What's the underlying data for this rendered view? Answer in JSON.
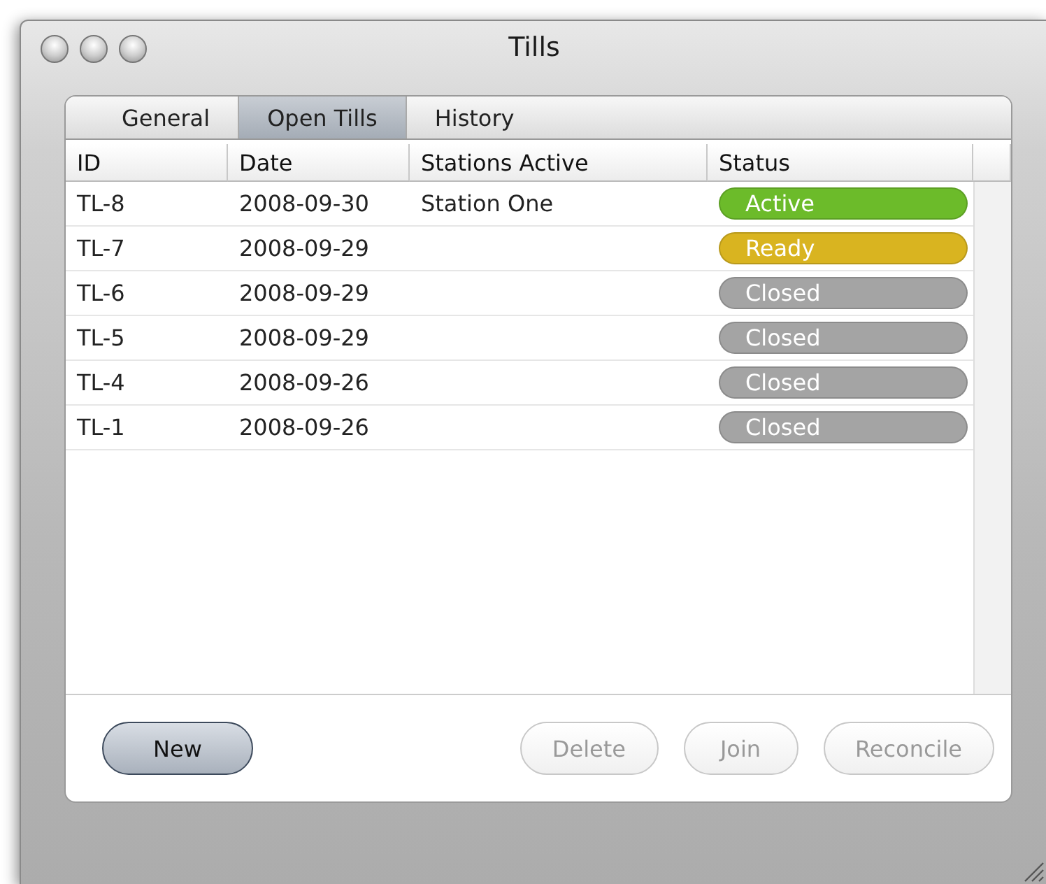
{
  "window": {
    "title": "Tills"
  },
  "tabs": [
    {
      "label": "General",
      "selected": false
    },
    {
      "label": "Open Tills",
      "selected": true
    },
    {
      "label": "History",
      "selected": false
    }
  ],
  "table": {
    "columns": [
      "ID",
      "Date",
      "Stations Active",
      "Status"
    ],
    "rows": [
      {
        "id": "TL-8",
        "date": "2008-09-30",
        "stations": "Station One",
        "status": "Active",
        "color": "#6cbb2a"
      },
      {
        "id": "TL-7",
        "date": "2008-09-29",
        "status": "Ready",
        "color": "#d9b420"
      },
      {
        "id": "TL-6",
        "date": "2008-09-29",
        "status": "Closed",
        "color": "#a4a4a4"
      },
      {
        "id": "TL-5",
        "date": "2008-09-29",
        "status": "Closed",
        "color": "#a4a4a4"
      },
      {
        "id": "TL-4",
        "date": "2008-09-26",
        "status": "Closed",
        "color": "#a4a4a4"
      },
      {
        "id": "TL-1",
        "date": "2008-09-26",
        "status": "Closed",
        "color": "#a4a4a4"
      }
    ]
  },
  "buttons": [
    {
      "label": "New",
      "disabled": false,
      "default": true
    },
    {
      "label": "Delete",
      "disabled": true,
      "default": false
    },
    {
      "label": "Join",
      "disabled": true,
      "default": false
    },
    {
      "label": "Reconcile",
      "disabled": true,
      "default": false
    }
  ]
}
